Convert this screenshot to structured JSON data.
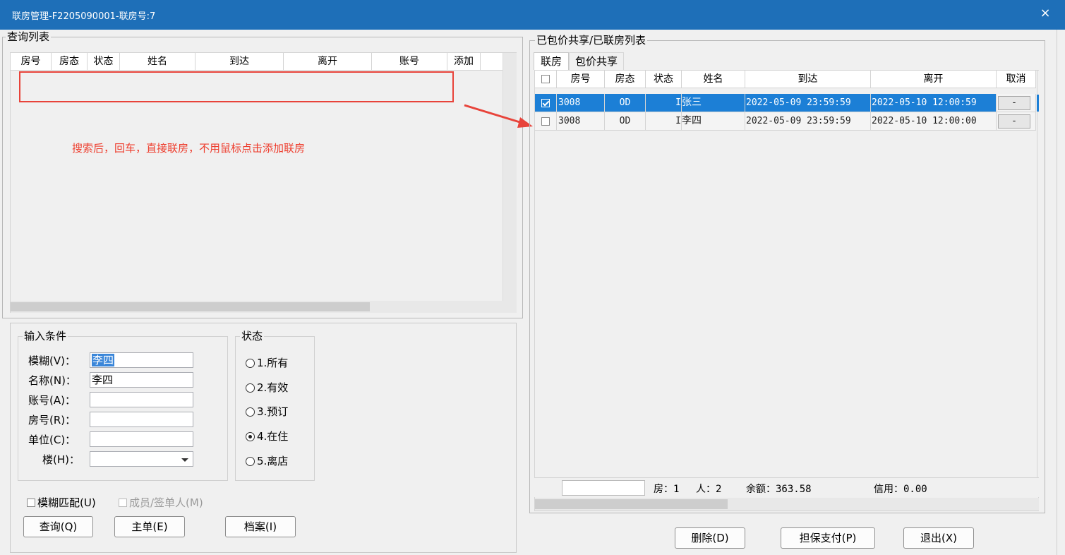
{
  "window": {
    "title": "联房管理-F2205090001-联房号:7",
    "close_glyph": "×"
  },
  "left": {
    "query_list_label": "查询列表",
    "columns": [
      "房号",
      "房态",
      "状态",
      "姓名",
      "到达",
      "离开",
      "账号",
      "添加"
    ],
    "annotation": "搜索后，回车，直接联房，不用鼠标点击添加联房"
  },
  "conditions": {
    "label": "输入条件",
    "fuzzy": {
      "label": "模糊(V)：",
      "value": "李四"
    },
    "name": {
      "label": "名称(N)：",
      "value": "李四"
    },
    "account": {
      "label": "账号(A)：",
      "value": ""
    },
    "room": {
      "label": "房号(R)：",
      "value": ""
    },
    "unit": {
      "label": "单位(C)：",
      "value": ""
    },
    "building": {
      "label": "楼(H)：",
      "value": ""
    }
  },
  "status": {
    "label": "状态",
    "options": [
      "1.所有",
      "2.有效",
      "3.预订",
      "4.在住",
      "5.离店"
    ],
    "selected_index": 3
  },
  "checks": {
    "fuzzy_match": "模糊匹配(U)",
    "members": "成员/签单人(M)"
  },
  "left_buttons": {
    "query": "查询(Q)",
    "master": "主单(E)",
    "archive": "档案(I)"
  },
  "right": {
    "group_label": "已包价共享/已联房列表",
    "tabs": [
      "联房",
      "包价共享"
    ],
    "columns": [
      "房号",
      "房态",
      "状态",
      "姓名",
      "到达",
      "离开",
      "取消"
    ],
    "rows": [
      {
        "checked": true,
        "room": "3008",
        "room_state": "OD",
        "status": "I",
        "name": "张三",
        "arrive": "2022-05-09 23:59:59",
        "depart": "2022-05-10 12:00:59",
        "cancel": "-",
        "selected": true
      },
      {
        "checked": false,
        "room": "3008",
        "room_state": "OD",
        "status": "I",
        "name": "李四",
        "arrive": "2022-05-09 23:59:59",
        "depart": "2022-05-10 12:00:00",
        "cancel": "-",
        "selected": false
      }
    ],
    "summary": {
      "rooms": "房：1",
      "people": "人：2",
      "balance": "余额：363.58",
      "credit": "信用：0.00"
    }
  },
  "bottom_buttons": {
    "delete": "删除(D)",
    "guarantee": "担保支付(P)",
    "exit": "退出(X)"
  },
  "colors": {
    "titlebar": "#1e6fb8",
    "selection": "#1c7fd6",
    "annotation": "#ee3c2c"
  }
}
